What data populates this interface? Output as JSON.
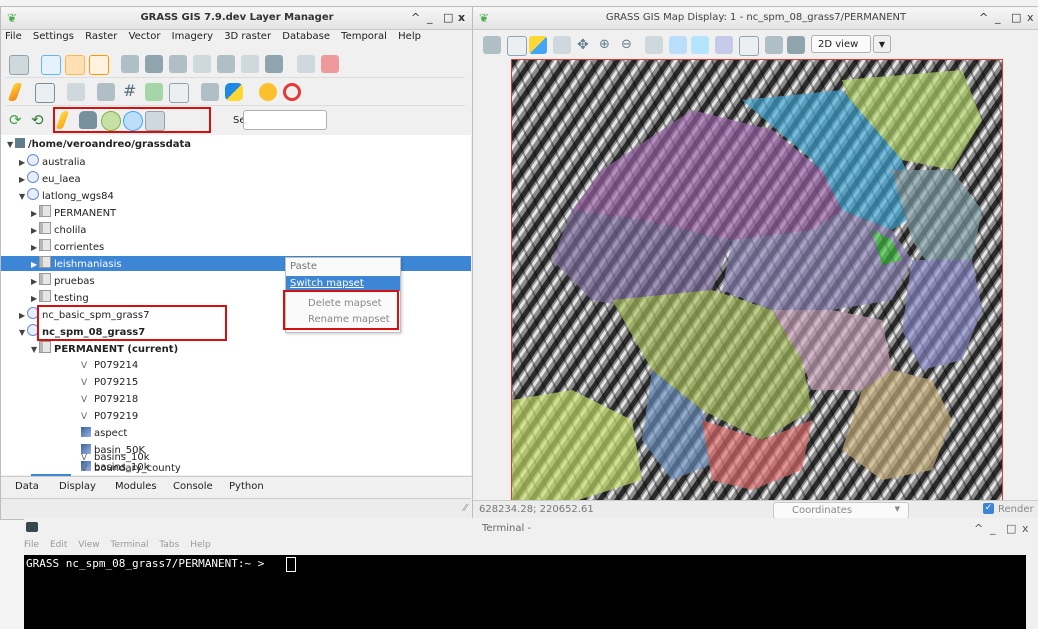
{
  "layer_manager": {
    "title": "GRASS GIS 7.9.dev Layer Manager",
    "window_controls": [
      "^",
      "_",
      "□",
      "x"
    ],
    "menu": [
      "File",
      "Settings",
      "Raster",
      "Vector",
      "Imagery",
      "3D raster",
      "Database",
      "Temporal",
      "Help"
    ],
    "search_label": "Search:",
    "search_value": "",
    "tree": {
      "root": "/home/veroandreo/grassdata",
      "locations": [
        {
          "label": "australia"
        },
        {
          "label": "eu_laea"
        },
        {
          "label": "latlong_wgs84"
        }
      ],
      "latlong_mapsets": [
        "PERMANENT",
        "cholila",
        "corrientes",
        "leishmaniasis",
        "pruebas",
        "testing"
      ],
      "selected_mapset": "leishmaniasis",
      "nc_basic": "nc_basic_spm_grass7",
      "nc_spm": "nc_spm_08_grass7",
      "current_mapset": "PERMANENT  (current)",
      "layers": [
        {
          "type": "vector",
          "name": "P079214"
        },
        {
          "type": "vector",
          "name": "P079215"
        },
        {
          "type": "vector",
          "name": "P079218"
        },
        {
          "type": "vector",
          "name": "P079219"
        },
        {
          "type": "raster",
          "name": "aspect"
        },
        {
          "type": "raster",
          "name": "basin_50K"
        },
        {
          "type": "raster",
          "name": "basins_10k"
        },
        {
          "type": "vector",
          "name": "basins_10k"
        },
        {
          "type": "vector",
          "name": "boundary_county"
        }
      ]
    },
    "context_menu": {
      "paste": "Paste",
      "switch": "Switch mapset",
      "delete": "Delete mapset",
      "rename": "Rename mapset"
    },
    "tabs": [
      "Data",
      "Display",
      "Modules",
      "Console",
      "Python"
    ]
  },
  "map_display": {
    "title": "GRASS GIS Map Display: 1 - nc_spm_08_grass7/PERMANENT",
    "window_controls": [
      "^",
      "_",
      "□",
      "x"
    ],
    "view_mode": "2D view",
    "coordinates_value": "628234.28; 220652.61",
    "status_select": "Coordinates",
    "render_label": "Render",
    "render_checked": true
  },
  "terminal": {
    "title": "Terminal -",
    "window_controls": [
      "^",
      "_",
      "□",
      "x"
    ],
    "menu": [
      "File",
      "Edit",
      "View",
      "Terminal",
      "Tabs",
      "Help"
    ],
    "prompt": "GRASS nc_spm_08_grass7/PERMANENT:~ > "
  }
}
